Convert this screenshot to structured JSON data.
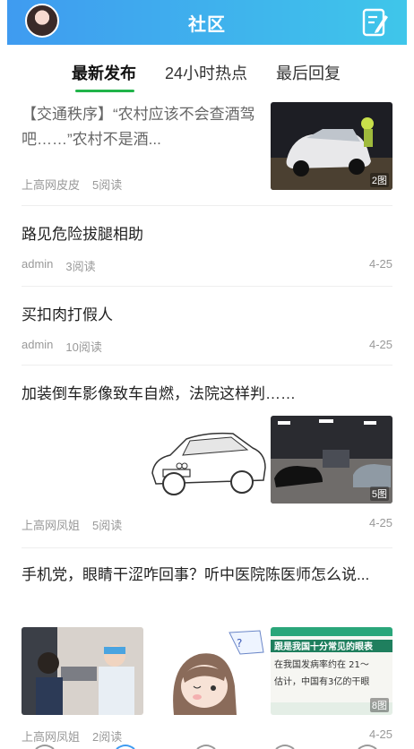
{
  "header": {
    "title": "社区"
  },
  "tabs": [
    {
      "label": "最新发布",
      "active": true
    },
    {
      "label": "24小时热点",
      "active": false
    },
    {
      "label": "最后回复",
      "active": false
    }
  ],
  "posts": [
    {
      "title": "【交通秩序】“农村应该不会查酒驾吧……”农村不是酒...",
      "author": "上高网皮皮",
      "reads": "5阅读",
      "date": "",
      "image_count": "2图"
    },
    {
      "title": "路见危险拔腿相助",
      "author": "admin",
      "reads": "3阅读",
      "date": "4-25"
    },
    {
      "title": "买扣肉打假人",
      "author": "admin",
      "reads": "10阅读",
      "date": "4-25"
    },
    {
      "title": "加装倒车影像致车自燃，法院这样判……",
      "author": "上高网凤姐",
      "reads": "5阅读",
      "date": "4-25",
      "image_count": "5图"
    },
    {
      "title": "手机党，眼睛干涩咋回事？听中医院陈医师怎么说...",
      "author": "上高网凤姐",
      "reads": "2阅读",
      "date": "4-25",
      "image_count": "8图",
      "poster_text": [
        "跟是我国十分常见的眼表",
        "在我国发病率约在 21～",
        "估计，中国有3亿的干眼"
      ]
    }
  ],
  "colors": {
    "header_start": "#3f9bf0",
    "header_end": "#3fc6ea",
    "tab_accent": "#21b44a"
  }
}
